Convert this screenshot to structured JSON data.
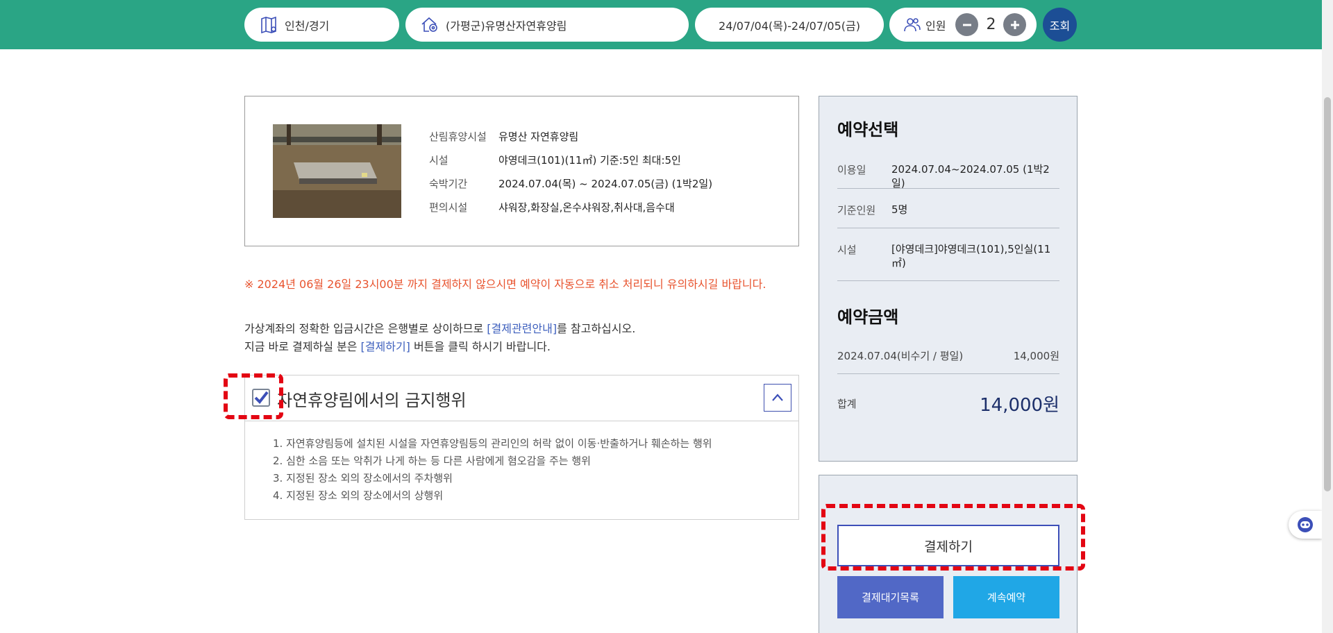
{
  "search": {
    "region": "인천/경기",
    "forest": "(가평군)유명산자연휴양림",
    "dates": "24/07/04(목)-24/07/05(금)",
    "people_label": "인원",
    "people_count": "2",
    "search_label": "조회"
  },
  "info": {
    "rows": [
      {
        "label": "산림휴양시설",
        "value": "유명산 자연휴양림"
      },
      {
        "label": "시설",
        "value": "야영데크(101)(11㎡) 기준:5인 최대:5인"
      },
      {
        "label": "숙박기간",
        "value": "2024.07.04(목) ~ 2024.07.05(금) (1박2일)"
      },
      {
        "label": "편의시설",
        "value": "샤워장,화장실,온수샤워장,취사대,음수대"
      }
    ]
  },
  "notice": {
    "warning": "※ 2024년 06월 26일 23시00분 까지 결제하지 않으시면 예약이 자동으로 취소 처리되니 유의하시길 바랍니다.",
    "line1_pre": "가상계좌의 정확한 입금시간은 은행별로 상이하므로 ",
    "line1_link": "[결제관련안내]",
    "line1_post": "를 참고하십시오.",
    "line2_pre": "지금 바로 결제하실 분은 ",
    "line2_link": "[결제하기]",
    "line2_post": " 버튼을 클릭 하시기 바랍니다."
  },
  "ban": {
    "title": "자연휴양림에서의 금지행위",
    "checked": true,
    "items": [
      "1. 자연휴양림등에 설치된 시설을 자연휴양림등의 관리인의 허락 없이 이동·반출하거나 훼손하는 행위",
      "2. 심한 소음 또는 악취가 나게 하는 등 다른 사람에게 혐오감을 주는 행위",
      "3. 지정된 장소 외의 장소에서의 주차행위",
      "4. 지정된 장소 외의 장소에서의 상행위"
    ]
  },
  "summary": {
    "title": "예약선택",
    "rows": [
      {
        "label": "이용일",
        "value": "2024.07.04~2024.07.05 (1박2일)"
      },
      {
        "label": "기준인원",
        "value": "5명"
      },
      {
        "label": "시설",
        "value": "[야영데크]야영데크(101),5인실(11㎡)"
      }
    ],
    "price_title": "예약금액",
    "price_row": {
      "label": "2024.07.04(비수기 / 평일)",
      "value": "14,000원"
    },
    "total": {
      "label": "합계",
      "value": "14,000원"
    }
  },
  "actions": {
    "pay": "결제하기",
    "wait_list": "결제대기목록",
    "continue": "계속예약"
  },
  "colors": {
    "header_green": "#2aa585",
    "search_navy": "#1c4e95",
    "warning_red": "#e8532e",
    "link_blue": "#3d5fbd",
    "highlight_red": "#e30613"
  }
}
